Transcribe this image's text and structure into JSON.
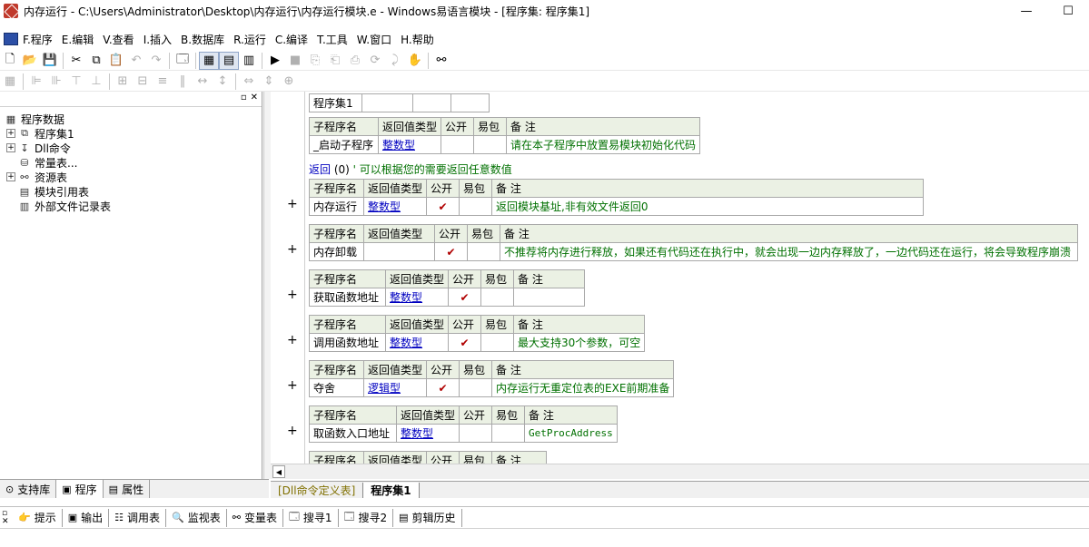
{
  "window": {
    "title": "内存运行 - C:\\Users\\Administrator\\Desktop\\内存运行\\内存运行模块.e - Windows易语言模块 - [程序集: 程序集1]",
    "minimize": "—",
    "maximize": "☐"
  },
  "menu": [
    "F.程序",
    "E.编辑",
    "V.查看",
    "I.插入",
    "B.数据库",
    "R.运行",
    "C.编译",
    "T.工具",
    "W.窗口",
    "H.帮助"
  ],
  "toolbar1": [
    "new-file-icon",
    "open-folder-icon",
    "save-icon",
    "cut-icon",
    "copy-icon",
    "paste-icon",
    "undo-icon",
    "redo-icon",
    "find-icon",
    "layout1-icon",
    "layout2-icon",
    "layout3-icon",
    "run-icon",
    "stop-icon",
    "step1-icon",
    "step2-icon",
    "step3-icon",
    "step4-icon",
    "step5-icon",
    "hand-icon",
    "binoculars-icon"
  ],
  "left_panel": {
    "tree": [
      {
        "label": "程序数据",
        "icon": "database-icon",
        "indent": 0,
        "toggle": ""
      },
      {
        "label": "程序集1",
        "icon": "stack-icon",
        "indent": 1,
        "toggle": "+"
      },
      {
        "label": "Dll命令",
        "icon": "dll-icon",
        "indent": 1,
        "toggle": "+"
      },
      {
        "label": "常量表...",
        "icon": "constant-icon",
        "indent": 1,
        "toggle": ""
      },
      {
        "label": "资源表",
        "icon": "resource-icon",
        "indent": 1,
        "toggle": "+"
      },
      {
        "label": "模块引用表",
        "icon": "module-icon",
        "indent": 1,
        "toggle": ""
      },
      {
        "label": "外部文件记录表",
        "icon": "file-icon",
        "indent": 1,
        "toggle": ""
      }
    ],
    "tabs": [
      {
        "label": "支持库",
        "icon": "library-icon"
      },
      {
        "label": "程序",
        "icon": "program-icon"
      },
      {
        "label": "属性",
        "icon": "property-icon"
      }
    ]
  },
  "editor": {
    "assembly_name": "程序集1",
    "headers": {
      "name": "子程序名",
      "ret": "返回值类型",
      "public": "公开",
      "easy": "易包",
      "remark": "备 注"
    },
    "code_line": {
      "kw": "返回",
      "arg": " (0) ",
      "comment": "' 可以根据您的需要返回任意数值"
    },
    "subs": [
      {
        "name": "_启动子程序",
        "ret": "整数型",
        "public": "",
        "easy": "",
        "remark": "请在本子程序中放置易模块初始化代码",
        "plus": ""
      },
      {
        "name": "内存运行",
        "ret": "整数型",
        "public": "✔",
        "easy": "",
        "remark": "返回模块基址,非有效文件返回0",
        "plus": "+"
      },
      {
        "name": "内存卸载",
        "ret": "",
        "public": "✔",
        "easy": "",
        "remark": "不推荐将内存进行释放，如果还有代码还在执行中，就会出现一边内存释放了，一边代码还在运行，将会导致程序崩溃",
        "plus": "+"
      },
      {
        "name": "获取函数地址",
        "ret": "整数型",
        "public": "✔",
        "easy": "",
        "remark": "",
        "plus": "+"
      },
      {
        "name": "调用函数地址",
        "ret": "整数型",
        "public": "✔",
        "easy": "",
        "remark": "最大支持30个参数，可空",
        "plus": "+"
      },
      {
        "name": "夺舍",
        "ret": "逻辑型",
        "public": "✔",
        "easy": "",
        "remark": "内存运行无重定位表的EXE前期准备",
        "plus": "+"
      },
      {
        "name": "取函数入口地址",
        "ret": "整数型",
        "public": "",
        "easy": "",
        "remark": "GetProcAddress",
        "plus": "+"
      }
    ]
  },
  "doc_tabs": [
    "[Dll命令定义表]",
    "程序集1"
  ],
  "bottom_tabs": [
    {
      "label": "提示",
      "icon": "hint-icon"
    },
    {
      "label": "输出",
      "icon": "output-icon"
    },
    {
      "label": "调用表",
      "icon": "callstack-icon"
    },
    {
      "label": "监视表",
      "icon": "watch-icon"
    },
    {
      "label": "变量表",
      "icon": "variable-icon"
    },
    {
      "label": "搜寻1",
      "icon": "search1-icon"
    },
    {
      "label": "搜寻2",
      "icon": "search2-icon"
    },
    {
      "label": "剪辑历史",
      "icon": "clip-history-icon"
    }
  ]
}
